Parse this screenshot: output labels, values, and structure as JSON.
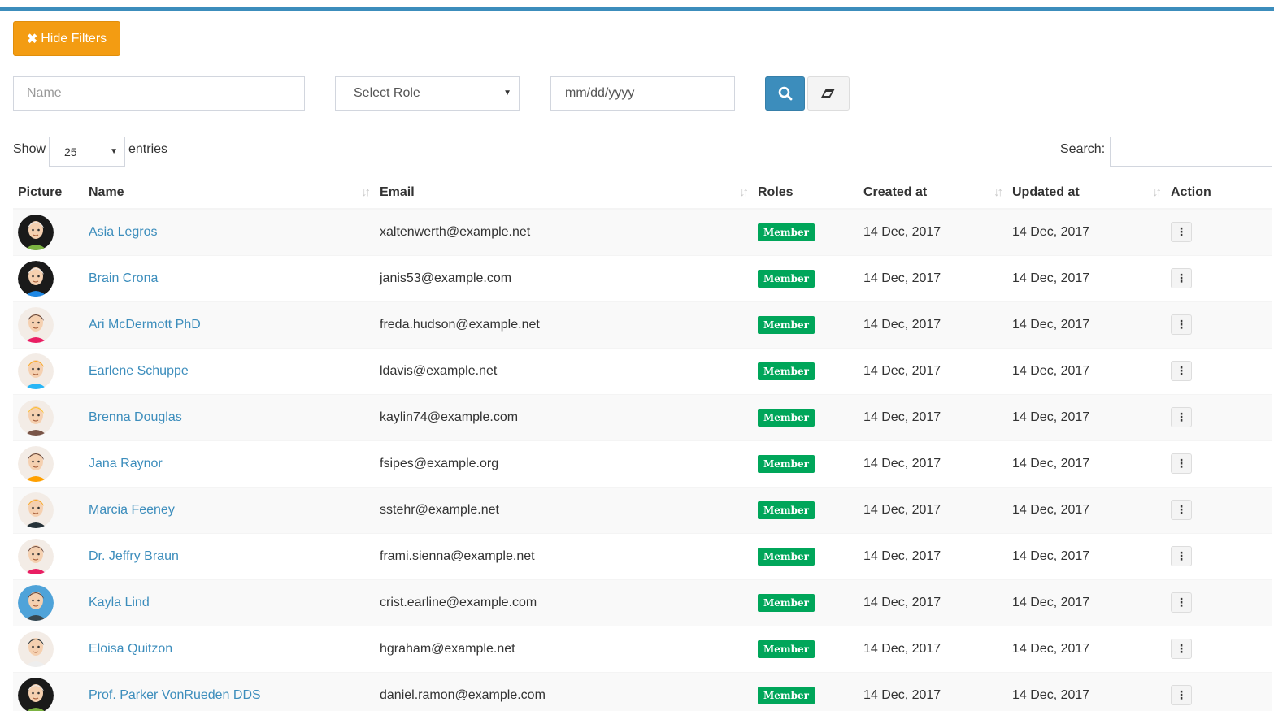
{
  "filters": {
    "hide_label": "Hide Filters",
    "name_placeholder": "Name",
    "role_placeholder": "Select Role",
    "date_placeholder": "mm/dd/yyyy"
  },
  "length": {
    "show_label": "Show",
    "value": "25",
    "entries_label": "entries"
  },
  "search": {
    "label": "Search:",
    "value": ""
  },
  "columns": {
    "picture": "Picture",
    "name": "Name",
    "email": "Email",
    "roles": "Roles",
    "created": "Created at",
    "updated": "Updated at",
    "action": "Action"
  },
  "colors": {
    "primary": "#3c8dbc",
    "warning": "#f39c12",
    "success": "#00a65a"
  },
  "rows": [
    {
      "name": "Asia Legros",
      "email": "xaltenwerth@example.net",
      "role": "Member",
      "created": "14 Dec, 2017",
      "updated": "14 Dec, 2017",
      "avatar": {
        "bg": "#1a1a1a",
        "skin": "#f5d0b0",
        "hair": "#e8e8e8",
        "shirt": "#7cb342"
      }
    },
    {
      "name": "Brain Crona",
      "email": "janis53@example.com",
      "role": "Member",
      "created": "14 Dec, 2017",
      "updated": "14 Dec, 2017",
      "avatar": {
        "bg": "#1a1a1a",
        "skin": "#f5d0b0",
        "hair": "#e8e8e8",
        "shirt": "#1e88e5"
      }
    },
    {
      "name": "Ari McDermott PhD",
      "email": "freda.hudson@example.net",
      "role": "Member",
      "created": "14 Dec, 2017",
      "updated": "14 Dec, 2017",
      "avatar": {
        "bg": "#f3ece6",
        "skin": "#f5d0b0",
        "hair": "#5d4037",
        "shirt": "#e91e63"
      }
    },
    {
      "name": "Earlene Schuppe",
      "email": "ldavis@example.net",
      "role": "Member",
      "created": "14 Dec, 2017",
      "updated": "14 Dec, 2017",
      "avatar": {
        "bg": "#f3ece6",
        "skin": "#f5d0b0",
        "hair": "#f9a825",
        "shirt": "#29b6f6"
      }
    },
    {
      "name": "Brenna Douglas",
      "email": "kaylin74@example.com",
      "role": "Member",
      "created": "14 Dec, 2017",
      "updated": "14 Dec, 2017",
      "avatar": {
        "bg": "#f3ece6",
        "skin": "#f5d0b0",
        "hair": "#fbc02d",
        "shirt": "#795548"
      }
    },
    {
      "name": "Jana Raynor",
      "email": "fsipes@example.org",
      "role": "Member",
      "created": "14 Dec, 2017",
      "updated": "14 Dec, 2017",
      "avatar": {
        "bg": "#f3ece6",
        "skin": "#f5d0b0",
        "hair": "#5d4037",
        "shirt": "#ffa000"
      }
    },
    {
      "name": "Marcia Feeney",
      "email": "sstehr@example.net",
      "role": "Member",
      "created": "14 Dec, 2017",
      "updated": "14 Dec, 2017",
      "avatar": {
        "bg": "#f3ece6",
        "skin": "#f5d0b0",
        "hair": "#f9a825",
        "shirt": "#263238"
      }
    },
    {
      "name": "Dr. Jeffry Braun",
      "email": "frami.sienna@example.net",
      "role": "Member",
      "created": "14 Dec, 2017",
      "updated": "14 Dec, 2017",
      "avatar": {
        "bg": "#f3ece6",
        "skin": "#f5d0b0",
        "hair": "#6d4c41",
        "shirt": "#e91e63"
      }
    },
    {
      "name": "Kayla Lind",
      "email": "crist.earline@example.com",
      "role": "Member",
      "created": "14 Dec, 2017",
      "updated": "14 Dec, 2017",
      "avatar": {
        "bg": "#4fa3d9",
        "skin": "#f5d0b0",
        "hair": "#5d4037",
        "shirt": "#37474f"
      }
    },
    {
      "name": "Eloisa Quitzon",
      "email": "hgraham@example.net",
      "role": "Member",
      "created": "14 Dec, 2017",
      "updated": "14 Dec, 2017",
      "avatar": {
        "bg": "#f3ece6",
        "skin": "#f5d0b0",
        "hair": "#263238",
        "shirt": "#eeeeee"
      }
    },
    {
      "name": "Prof. Parker VonRueden DDS",
      "email": "daniel.ramon@example.com",
      "role": "Member",
      "created": "14 Dec, 2017",
      "updated": "14 Dec, 2017",
      "avatar": {
        "bg": "#1a1a1a",
        "skin": "#f5d0b0",
        "hair": "#e8e8e8",
        "shirt": "#7cb342"
      }
    }
  ]
}
